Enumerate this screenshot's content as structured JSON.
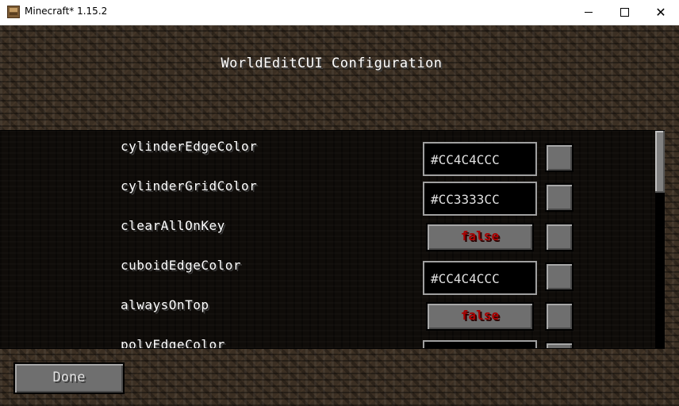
{
  "window": {
    "title": "Minecraft* 1.15.2",
    "minimize_icon": "minimize-icon",
    "maximize_icon": "maximize-icon",
    "close_icon": "close-icon",
    "close_glyph": "✕"
  },
  "screen": {
    "title": "WorldEditCUI Configuration"
  },
  "options": [
    {
      "label": "cylinderEdgeColor",
      "type": "text",
      "value": "#CC4C4CCC"
    },
    {
      "label": "cylinderGridColor",
      "type": "text",
      "value": "#CC3333CC"
    },
    {
      "label": "clearAllOnKey",
      "type": "toggle",
      "value": "false"
    },
    {
      "label": "cuboidEdgeColor",
      "type": "text",
      "value": "#CC4C4CCC"
    },
    {
      "label": "alwaysOnTop",
      "type": "toggle",
      "value": "false"
    },
    {
      "label": "polyEdgeColor",
      "type": "text",
      "value": ""
    }
  ],
  "footer": {
    "done_label": "Done"
  },
  "colors": {
    "toggle_false": "#aa0000",
    "text_field_border": "#a0a0a0"
  }
}
